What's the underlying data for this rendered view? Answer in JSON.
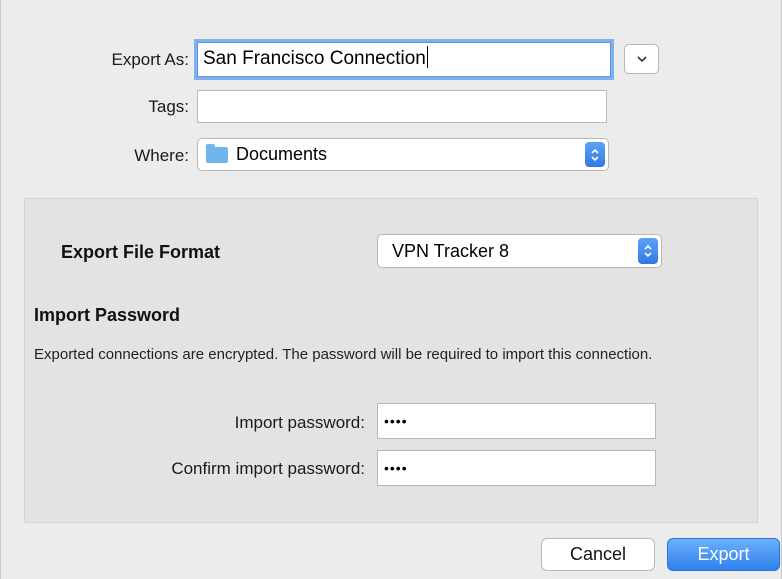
{
  "save_dialog": {
    "export_as_label": "Export As:",
    "export_as_value": "San Francisco Connection",
    "tags_label": "Tags:",
    "tags_value": "",
    "where_label": "Where:",
    "where_value": "Documents"
  },
  "export_options": {
    "format_label": "Export File Format",
    "format_value": "VPN Tracker 8",
    "password_heading": "Import Password",
    "description": "Exported connections are encrypted. The password will be required to import this connection.",
    "import_password_label": "Import password:",
    "import_password_mask": "••••",
    "confirm_password_label": "Confirm import password:",
    "confirm_password_mask": "••••"
  },
  "footer": {
    "cancel_label": "Cancel",
    "export_label": "Export"
  },
  "colors": {
    "accent": "#2f80ef",
    "focus_ring": "#7fb0f0",
    "folder": "#6fb6ec"
  }
}
